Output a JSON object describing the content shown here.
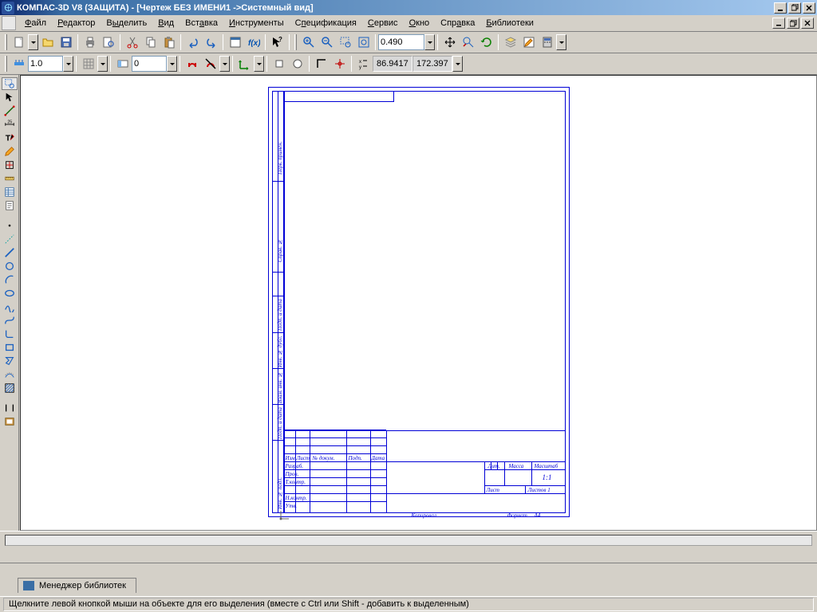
{
  "titlebar": {
    "title": "КОМПАС-3D V8 (ЗАЩИТА) - [Чертеж БЕЗ ИМЕНИ1 ->Системный вид]"
  },
  "menu": {
    "items": [
      "Файл",
      "Редактор",
      "Выделить",
      "Вид",
      "Вставка",
      "Инструменты",
      "Спецификация",
      "Сервис",
      "Окно",
      "Справка",
      "Библиотеки"
    ]
  },
  "toolbar2": {
    "zoom": "0.490",
    "lineweight": "1.0",
    "style": "0",
    "coord_x": "86.9417",
    "coord_y": "172.397"
  },
  "drawing": {
    "stamp": {
      "lit": "Лит.",
      "massa": "Масса",
      "mashtab": "Масштаб",
      "scale": "1:1",
      "list": "Лист",
      "listov": "Листов 1",
      "izm": "Изм.",
      "listn": "Лист",
      "ndokum": "№ докум.",
      "podp": "Подп.",
      "data": "Дата",
      "razrab": "Разраб.",
      "prov": "Пров.",
      "tkontr": "Т.контр.",
      "nkontr": "Н.контр.",
      "utv": "Утв.",
      "kopir": "Копировал",
      "format": "Формат",
      "fmt": "A4"
    },
    "side": {
      "perv": "Перв. примен.",
      "sprav": "Справ. №",
      "podpdata": "Подп. и дата",
      "invdubl": "Инв. № дубл.",
      "vzam": "Взам. инв. №",
      "podpdata2": "Подп. и дата",
      "invpodl": "Инв. № подл."
    }
  },
  "library": {
    "tab": "Менеджер библиотек"
  },
  "status": {
    "text": "Щелкните левой кнопкой мыши на объекте для его выделения (вместе с Ctrl или Shift - добавить к выделенным)"
  }
}
